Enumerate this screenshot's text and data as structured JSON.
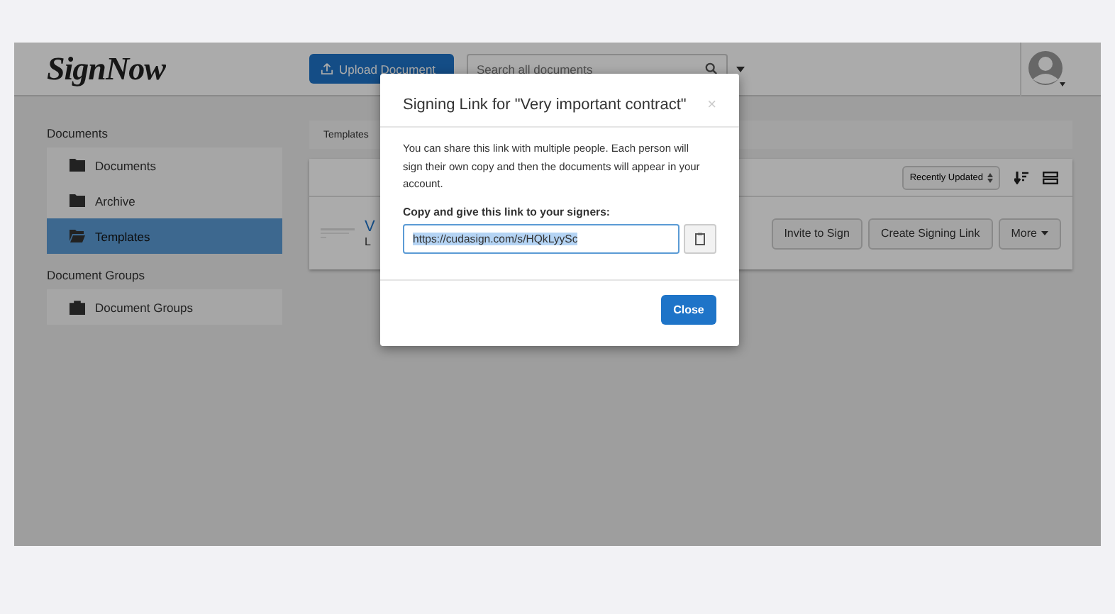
{
  "header": {
    "logo": "SignNow",
    "upload_button": "Upload Document",
    "search": {
      "placeholder": "Search all documents"
    }
  },
  "sidebar": {
    "sections": [
      {
        "title": "Documents",
        "items": [
          {
            "label": "Documents",
            "kind": "folder",
            "selected": false
          },
          {
            "label": "Archive",
            "kind": "folder",
            "selected": false
          },
          {
            "label": "Templates",
            "kind": "folder-open",
            "selected": true
          }
        ]
      },
      {
        "title": "Document Groups",
        "items": [
          {
            "label": "Document Groups",
            "kind": "briefcase",
            "selected": false
          }
        ]
      }
    ]
  },
  "main": {
    "breadcrumb": "Templates",
    "sort_select": "Recently Updated",
    "rows": [
      {
        "title": "V",
        "subtitle": "L",
        "actions": [
          "Invite to Sign",
          "Create Signing Link",
          "More"
        ]
      }
    ]
  },
  "modal": {
    "title": "Signing Link for \"Very important contract\"",
    "close_symbol": "×",
    "description": "You can share this link with multiple people. Each person will sign their own copy and then the documents will appear in your account.",
    "link_label": "Copy and give this link to your signers:",
    "link_value": "https://cudasign.com/s/HQkLyySc",
    "close_button": "Close"
  }
}
